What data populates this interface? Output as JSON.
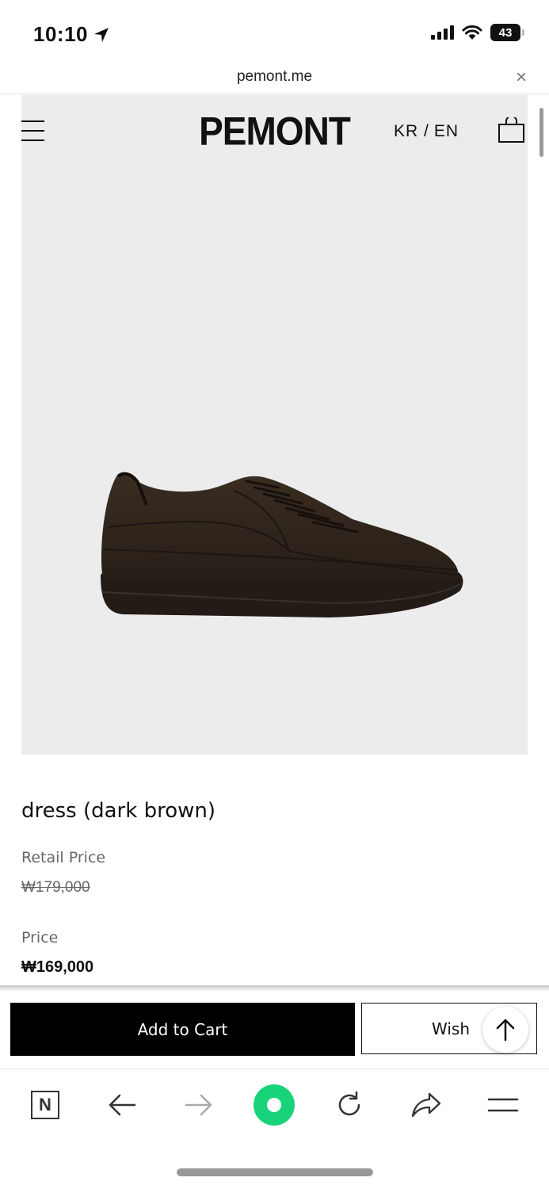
{
  "status_bar": {
    "time": "10:10",
    "battery": "43"
  },
  "browser": {
    "url": "pemont.me",
    "close": "×"
  },
  "header": {
    "logo": "PEMONT",
    "lang_kr": "KR /",
    "lang_en": "EN"
  },
  "product": {
    "name": "dress (dark brown)",
    "retail_label": "Retail Price",
    "retail_price": "₩179,000",
    "price_label": "Price",
    "price": "₩169,000"
  },
  "actions": {
    "add_to_cart": "Add to Cart",
    "wish": "Wish"
  },
  "toolbar": {
    "n_label": "N"
  },
  "colors": {
    "accent": "#19d37a",
    "primary": "#000000",
    "hero_bg": "#ececec"
  }
}
